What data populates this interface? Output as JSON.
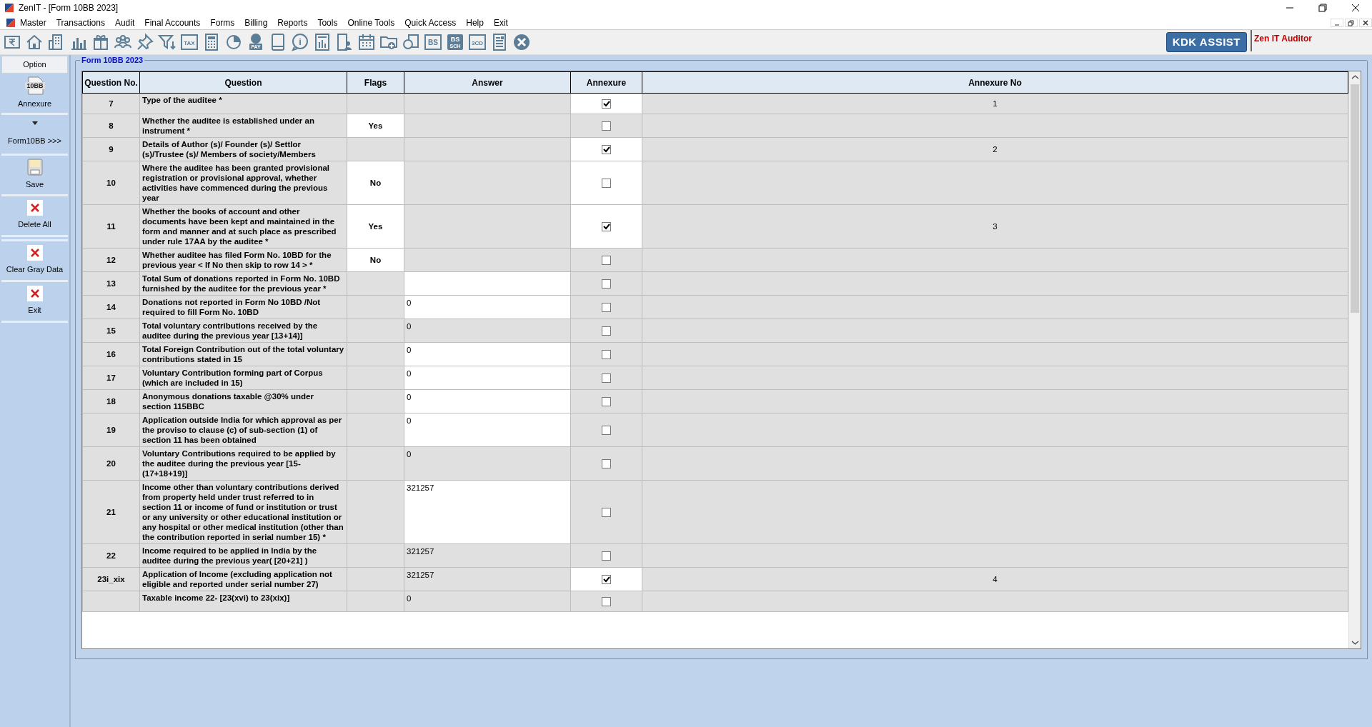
{
  "window": {
    "title": "ZenIT - [Form 10BB 2023]"
  },
  "menu": [
    "Master",
    "Transactions",
    "Audit",
    "Final Accounts",
    "Forms",
    "Billing",
    "Reports",
    "Tools",
    "Online Tools",
    "Quick Access",
    "Help",
    "Exit"
  ],
  "toolbar": [
    {
      "kind": "rupee"
    },
    {
      "kind": "home"
    },
    {
      "kind": "building"
    },
    {
      "kind": "chart"
    },
    {
      "kind": "gift"
    },
    {
      "kind": "people"
    },
    {
      "kind": "pin"
    },
    {
      "kind": "filter"
    },
    {
      "kind": "tag",
      "label": "TAX"
    },
    {
      "kind": "calculator"
    },
    {
      "kind": "pie"
    },
    {
      "kind": "pay",
      "label": "PAY"
    },
    {
      "kind": "book"
    },
    {
      "kind": "info",
      "label": "i"
    },
    {
      "kind": "report"
    },
    {
      "kind": "person"
    },
    {
      "kind": "calendar"
    },
    {
      "kind": "folder"
    },
    {
      "kind": "refresh"
    },
    {
      "kind": "tag",
      "label": "BS"
    },
    {
      "kind": "tag2",
      "label": "BS",
      "sublabel": "SCH"
    },
    {
      "kind": "tag",
      "label": "3CD"
    },
    {
      "kind": "doc"
    },
    {
      "kind": "close"
    }
  ],
  "assist": {
    "button": "KDK ASSIST",
    "label": "Zen IT Auditor"
  },
  "sidebar": {
    "header": "Option",
    "items": [
      {
        "kind": "doc",
        "icon_label": "10BB",
        "label": "Annexure"
      },
      {
        "kind": "dropdown",
        "label": "Form10BB >>>"
      },
      {
        "kind": "save",
        "label": "Save"
      },
      {
        "kind": "delete",
        "label": "Delete All"
      },
      {
        "kind": "delete",
        "label": "Clear Gray Data"
      },
      {
        "kind": "delete",
        "label": "Exit"
      }
    ]
  },
  "form": {
    "title": "Form 10BB 2023",
    "columns": [
      "Question No.",
      "Question",
      "Flags",
      "Answer",
      "Annexure",
      "Annexure No"
    ],
    "rows": [
      {
        "no": "7",
        "question": "Type of the auditee *",
        "flags_editable": false,
        "answer_editable": false,
        "annexure_checked": true,
        "annexure_editable": true,
        "annexure_no": "1"
      },
      {
        "no": "8",
        "question": "Whether the auditee is established under an instrument *",
        "flags": "Yes",
        "flags_editable": true,
        "answer_editable": false,
        "annexure_checked": false,
        "annexure_editable": false
      },
      {
        "no": "9",
        "question": "Details of Author (s)/ Founder (s)/ Settlor (s)/Trustee (s)/ Members of society/Members",
        "flags_editable": false,
        "answer_editable": false,
        "annexure_checked": true,
        "annexure_editable": true,
        "annexure_no": "2"
      },
      {
        "no": "10",
        "question": "Where the auditee has been granted provisional registration or provisional approval, whether activities have commenced during the previous year",
        "flags": "No",
        "flags_editable": true,
        "answer_editable": false,
        "annexure_checked": false,
        "annexure_editable": true
      },
      {
        "no": "11",
        "question": "Whether the books of account and other documents have been kept and maintained in the form and manner and at such place as prescribed under rule 17AA by the auditee *",
        "flags": "Yes",
        "flags_editable": true,
        "answer_editable": false,
        "annexure_checked": true,
        "annexure_editable": true,
        "annexure_no": "3"
      },
      {
        "no": "12",
        "question": "Whether auditee has filed Form No. 10BD for the previous year < If No then skip to row 14 > *",
        "flags": "No",
        "flags_editable": true,
        "answer_editable": false,
        "annexure_checked": false,
        "annexure_editable": false
      },
      {
        "no": "13",
        "question": "Total Sum of donations reported in Form No. 10BD furnished by the auditee for the previous year *",
        "flags_editable": false,
        "answer_editable": true,
        "annexure_checked": false,
        "annexure_editable": false
      },
      {
        "no": "14",
        "question": "Donations not reported in Form No 10BD /Not required to fill Form No. 10BD",
        "flags_editable": false,
        "answer": "0",
        "answer_editable": true,
        "annexure_checked": false,
        "annexure_editable": false
      },
      {
        "no": "15",
        "question": "Total voluntary contributions received by the auditee during the previous year [13+14)]",
        "flags_editable": false,
        "answer": "0",
        "answer_editable": false,
        "annexure_checked": false,
        "annexure_editable": false
      },
      {
        "no": "16",
        "question": "Total Foreign Contribution out of the total voluntary contributions stated in 15",
        "flags_editable": false,
        "answer": "0",
        "answer_editable": true,
        "annexure_checked": false,
        "annexure_editable": false
      },
      {
        "no": "17",
        "question": "Voluntary Contribution forming part of Corpus (which are included in 15)",
        "flags_editable": false,
        "answer": "0",
        "answer_editable": true,
        "annexure_checked": false,
        "annexure_editable": false
      },
      {
        "no": "18",
        "question": "Anonymous donations taxable @30% under section 115BBC",
        "flags_editable": false,
        "answer": "0",
        "answer_editable": true,
        "annexure_checked": false,
        "annexure_editable": false
      },
      {
        "no": "19",
        "question": "Application outside India for which approval as per the proviso to clause (c) of sub-section (1) of section 11 has been obtained",
        "flags_editable": false,
        "answer": "0",
        "answer_editable": true,
        "annexure_checked": false,
        "annexure_editable": false
      },
      {
        "no": "20",
        "question": "Voluntary Contributions required to be applied by the auditee during the previous year [15-(17+18+19)]",
        "flags_editable": false,
        "answer": "0",
        "answer_editable": false,
        "annexure_checked": false,
        "annexure_editable": false
      },
      {
        "no": "21",
        "question": "Income other than voluntary contributions derived from property held under trust referred to in section 11 or income of fund or institution or trust or any university or other educational institution or any hospital or other medical institution (other than the contribution reported in serial number 15) *",
        "flags_editable": false,
        "answer": "321257",
        "answer_editable": true,
        "annexure_checked": false,
        "annexure_editable": false
      },
      {
        "no": "22",
        "question": "Income required to be applied in India by the auditee during the previous year( [20+21] )",
        "flags_editable": false,
        "answer": "321257",
        "answer_editable": false,
        "annexure_checked": false,
        "annexure_editable": false
      },
      {
        "no": "23i_xix",
        "question": "Application of Income (excluding application not eligible and reported under serial number 27)",
        "flags_editable": false,
        "answer": "321257",
        "answer_editable": false,
        "annexure_checked": true,
        "annexure_editable": true,
        "annexure_no": "4"
      },
      {
        "question": "Taxable income 22- [23(xvi) to 23(xix)]",
        "flags_editable": false,
        "answer": "0",
        "answer_editable": false,
        "annexure_checked": false,
        "annexure_editable": false
      }
    ]
  }
}
